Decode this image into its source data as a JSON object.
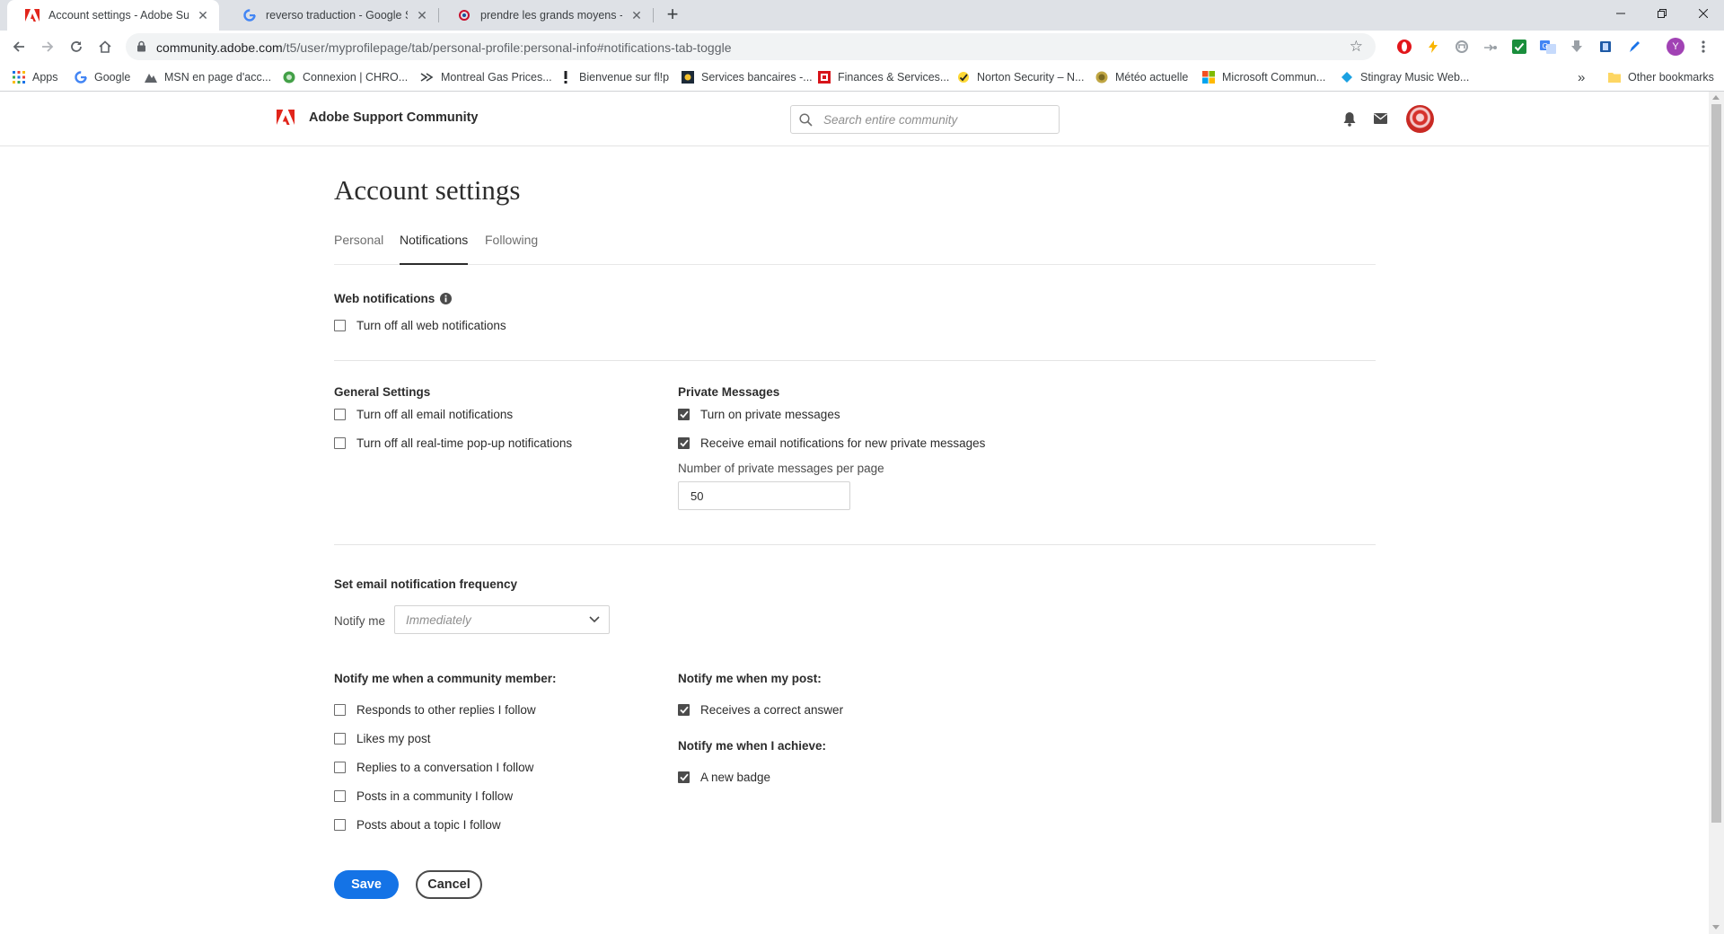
{
  "browser": {
    "tabs": [
      {
        "title": "Account settings - Adobe Suppo",
        "active": true,
        "icon": "adobe-icon"
      },
      {
        "title": "reverso traduction - Google Sear",
        "active": false,
        "icon": "google-icon"
      },
      {
        "title": "prendre les grands moyens - Trad",
        "active": false,
        "icon": "reverso-icon"
      }
    ],
    "new_tab": "+",
    "url_host": "community.adobe.com",
    "url_path": "/t5/user/myprofilepage/tab/personal-profile:personal-info#notifications-tab-toggle",
    "profile_initial": "Y",
    "bookmarks": [
      {
        "label": "Apps"
      },
      {
        "label": "Google"
      },
      {
        "label": "MSN en page d'acc..."
      },
      {
        "label": "Connexion | CHRO..."
      },
      {
        "label": "Montreal Gas Prices..."
      },
      {
        "label": "Bienvenue sur fl!p"
      },
      {
        "label": "Services bancaires -..."
      },
      {
        "label": "Finances & Services..."
      },
      {
        "label": "Norton Security – N..."
      },
      {
        "label": "Météo actuelle"
      },
      {
        "label": "Microsoft Commun..."
      },
      {
        "label": "Stingray Music Web..."
      }
    ],
    "more_bookmarks": "»",
    "other_bookmarks": "Other bookmarks"
  },
  "header": {
    "brand": "Adobe Support Community",
    "search_placeholder": "Search entire community"
  },
  "page": {
    "title": "Account settings",
    "tabs": [
      {
        "label": "Personal",
        "active": false
      },
      {
        "label": "Notifications",
        "active": true
      },
      {
        "label": "Following",
        "active": false
      }
    ]
  },
  "web_notifications": {
    "heading": "Web notifications",
    "items": [
      {
        "label": "Turn off all web notifications",
        "checked": false
      }
    ]
  },
  "general_settings": {
    "heading": "General Settings",
    "items": [
      {
        "label": "Turn off all email notifications",
        "checked": false
      },
      {
        "label": "Turn off all real-time pop-up notifications",
        "checked": false
      }
    ]
  },
  "private_messages": {
    "heading": "Private Messages",
    "items": [
      {
        "label": "Turn on private messages",
        "checked": true
      },
      {
        "label": "Receive email notifications for new private messages",
        "checked": true
      }
    ],
    "per_page_label": "Number of private messages per page",
    "per_page_value": "50"
  },
  "email_frequency": {
    "heading": "Set email notification frequency",
    "notify_label": "Notify me",
    "selected": "Immediately"
  },
  "community_member": {
    "heading": "Notify me when a community member:",
    "items": [
      {
        "label": "Responds to other replies I follow",
        "checked": false
      },
      {
        "label": "Likes my post",
        "checked": false
      },
      {
        "label": "Replies to a conversation I follow",
        "checked": false
      },
      {
        "label": "Posts in a community I follow",
        "checked": false
      },
      {
        "label": "Posts about a topic I follow",
        "checked": false
      }
    ]
  },
  "my_post": {
    "heading": "Notify me when my post:",
    "items": [
      {
        "label": "Receives a correct answer",
        "checked": true
      }
    ]
  },
  "achieve": {
    "heading": "Notify me when I achieve:",
    "items": [
      {
        "label": "A new badge",
        "checked": true
      }
    ]
  },
  "actions": {
    "save": "Save",
    "cancel": "Cancel"
  },
  "colors": {
    "accent": "#1473e6",
    "adobe_red": "#e1251b",
    "chrome_bg": "#dee1e6"
  }
}
